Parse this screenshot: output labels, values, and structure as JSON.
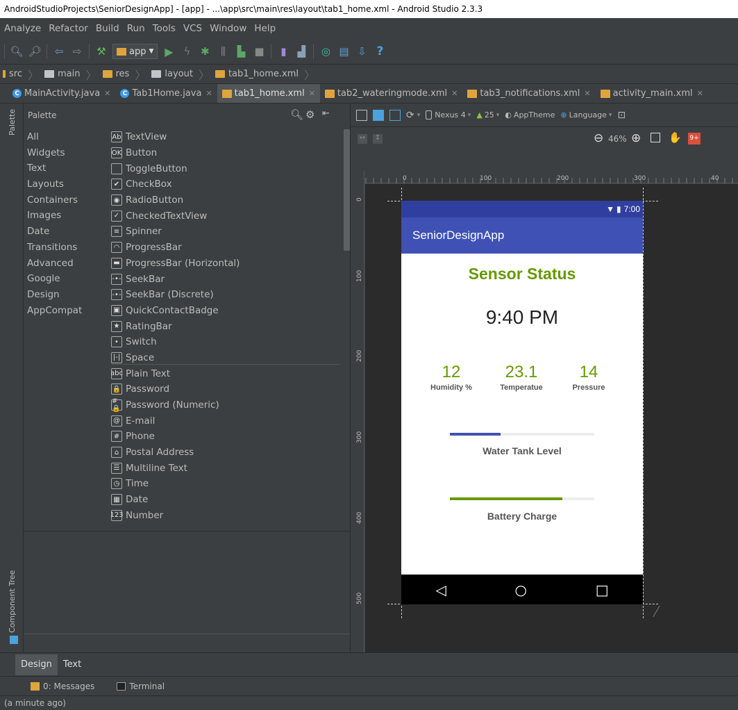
{
  "window": {
    "title": "AndroidStudioProjects\\SeniorDesignApp] - [app] - ...\\app\\src\\main\\res\\layout\\tab1_home.xml - Android Studio 2.3.3"
  },
  "menu": [
    "Analyze",
    "Refactor",
    "Build",
    "Run",
    "Tools",
    "VCS",
    "Window",
    "Help"
  ],
  "toolbar": {
    "app_config": "app",
    "help_icon": "?"
  },
  "breadcrumbs": [
    "src",
    "main",
    "res",
    "layout",
    "tab1_home.xml"
  ],
  "tabs": [
    {
      "label": "MainActivity.java",
      "kind": "class"
    },
    {
      "label": "Tab1Home.java",
      "kind": "class"
    },
    {
      "label": "tab1_home.xml",
      "kind": "xml",
      "active": true
    },
    {
      "label": "tab2_wateringmode.xml",
      "kind": "xml"
    },
    {
      "label": "tab3_notifications.xml",
      "kind": "xml"
    },
    {
      "label": "activity_main.xml",
      "kind": "xml"
    }
  ],
  "palette": {
    "title": "Palette",
    "categories": [
      "All",
      "Widgets",
      "Text",
      "Layouts",
      "Containers",
      "Images",
      "Date",
      "Transitions",
      "Advanced",
      "Google",
      "Design",
      "AppCompat"
    ],
    "items": [
      {
        "label": "TextView",
        "icon": "Ab"
      },
      {
        "label": "Button",
        "icon": "OK"
      },
      {
        "label": "ToggleButton",
        "icon": ""
      },
      {
        "label": "CheckBox",
        "icon": "✔"
      },
      {
        "label": "RadioButton",
        "icon": "◉"
      },
      {
        "label": "CheckedTextView",
        "icon": "✓"
      },
      {
        "label": "Spinner",
        "icon": "≡"
      },
      {
        "label": "ProgressBar",
        "icon": "◠"
      },
      {
        "label": "ProgressBar (Horizontal)",
        "icon": "▬"
      },
      {
        "label": "SeekBar",
        "icon": "-•-"
      },
      {
        "label": "SeekBar (Discrete)",
        "icon": "-•-"
      },
      {
        "label": "QuickContactBadge",
        "icon": "▣"
      },
      {
        "label": "RatingBar",
        "icon": "★"
      },
      {
        "label": "Switch",
        "icon": "•"
      },
      {
        "label": "Space",
        "icon": "|-|"
      },
      {
        "label": "Plain Text",
        "icon": "abc"
      },
      {
        "label": "Password",
        "icon": "🔒"
      },
      {
        "label": "Password (Numeric)",
        "icon": "#🔒"
      },
      {
        "label": "E-mail",
        "icon": "@"
      },
      {
        "label": "Phone",
        "icon": "#"
      },
      {
        "label": "Postal Address",
        "icon": "⌂"
      },
      {
        "label": "Multiline Text",
        "icon": "☰"
      },
      {
        "label": "Time",
        "icon": "◷"
      },
      {
        "label": "Date",
        "icon": "▦"
      },
      {
        "label": "Number",
        "icon": "123"
      }
    ]
  },
  "side_panels": {
    "palette": "Palette",
    "component_tree": "Component Tree"
  },
  "design_toolbar": {
    "device": "Nexus 4",
    "api": "25",
    "theme": "AppTheme",
    "language": "Language",
    "zoom": "46%"
  },
  "ruler": {
    "top": [
      "0",
      "100",
      "200",
      "300",
      "40"
    ],
    "left": [
      "0",
      "100",
      "200",
      "300",
      "400",
      "500"
    ]
  },
  "preview": {
    "status_time": "7:00",
    "app_title": "SeniorDesignApp",
    "heading": "Sensor Status",
    "time": "9:40 PM",
    "readings": [
      {
        "value": "12",
        "label": "Humidity %"
      },
      {
        "value": "23.1",
        "label": "Temperatue"
      },
      {
        "value": "14",
        "label": "Pressure"
      }
    ],
    "water_tank": {
      "label": "Water Tank Level",
      "progress": 0.35
    },
    "battery": {
      "label": "Battery Charge",
      "progress": 0.78
    },
    "colors": {
      "status_bar": "#303f9f",
      "app_bar": "#3f51b5",
      "accent_green": "#669900",
      "water_bar": "#3f51b5",
      "battery_bar": "#669900"
    }
  },
  "bottom_tabs": [
    "Design",
    "Text"
  ],
  "tool_windows": [
    "0: Messages",
    "Terminal"
  ],
  "status": "(a minute ago)"
}
